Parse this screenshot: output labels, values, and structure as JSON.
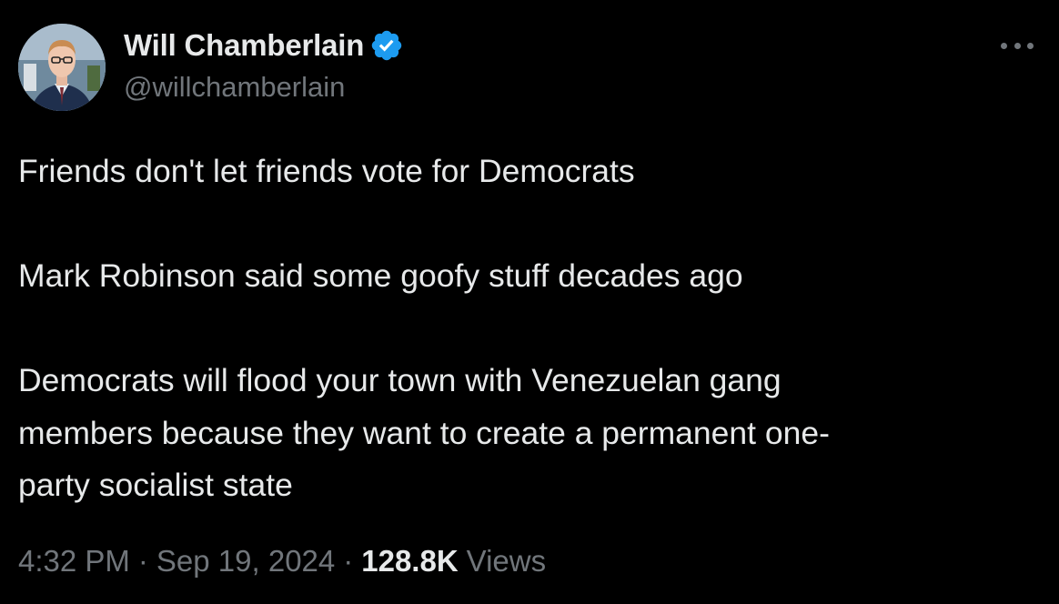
{
  "author": {
    "display_name": "Will Chamberlain",
    "handle": "@willchamberlain",
    "verified": true
  },
  "tweet": {
    "lines": {
      "l1": "Friends don't let friends vote for Democrats",
      "l2": "Mark Robinson said some goofy stuff decades ago",
      "l3": "Democrats will flood your town with Venezuelan gang",
      "l4": "members because they want to create a permanent one-",
      "l5": "party socialist state"
    }
  },
  "meta": {
    "time": "4:32 PM",
    "separator": "·",
    "date": "Sep 19, 2024",
    "views_count": "128.8K",
    "views_label": "Views"
  },
  "icons": {
    "verified": "verified-badge-icon",
    "more": "more-dots-icon"
  },
  "colors": {
    "background": "#000000",
    "primary_text": "#e7e9ea",
    "secondary_text": "#71767b",
    "verified_blue": "#1d9bf0"
  }
}
